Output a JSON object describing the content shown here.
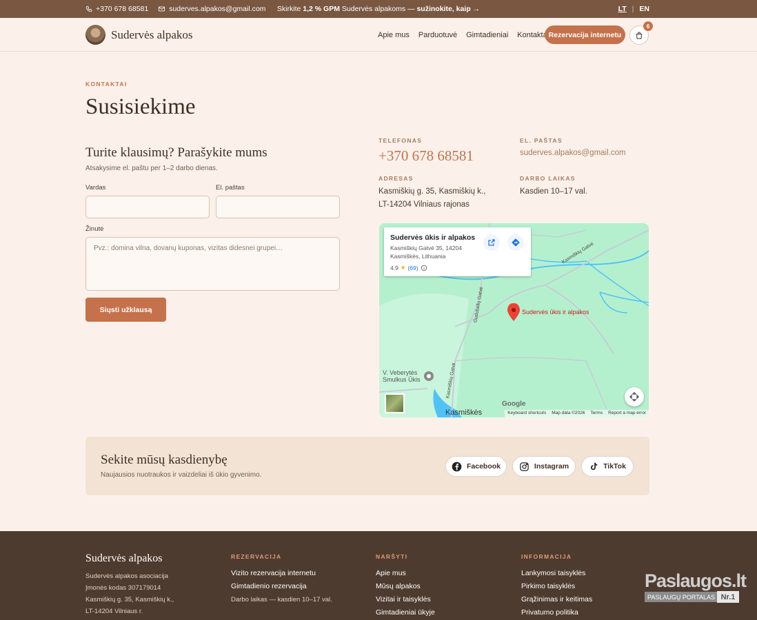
{
  "topbar": {
    "phone": "+370 678 68581",
    "email": "suderves.alpakos@gmail.com",
    "promo_prefix": "Skirkite",
    "promo_bold": "1,2 % GPM",
    "promo_middle": "Sudervės alpakoms —",
    "promo_link": "sužinokite, kaip →",
    "lang_lt": "LT",
    "lang_sep": "|",
    "lang_en": "EN"
  },
  "header": {
    "brand": "Sudervės alpakos",
    "nav": [
      "Apie mus",
      "Parduotuvė",
      "Gimtadieniai",
      "Kontaktai"
    ],
    "reserve_label": "Rezervacija internetu",
    "cart_count": "6"
  },
  "main": {
    "eyebrow": "KONTAKTAI",
    "title": "Susisiekime",
    "form": {
      "title": "Turite klausimų? Parašykite mums",
      "subtitle": "Atsakysime el. paštu per 1–2 darbo dienas.",
      "name_label": "Vardas",
      "email_label": "El. paštas",
      "message_label": "Žinutė",
      "message_placeholder": "Pvz.: domina vilna, dovanų kuponas, vizitas didesnei grupei…",
      "submit_label": "Siųsti užklausą"
    },
    "contact": {
      "phone_label": "TELEFONAS",
      "phone": "+370 678 68581",
      "email_label": "EL. PAŠTAS",
      "email": "suderves.alpakos@gmail.com",
      "address_label": "ADRESAS",
      "address_line1": "Kasmiškių g. 35, Kasmiškių k.,",
      "address_line2": "LT-14204 Vilniaus rajonas",
      "hours_label": "DARBO LAIKAS",
      "hours": "Kasdien 10–17 val."
    },
    "map": {
      "card_title": "Sudervės ūkis ir alpakos",
      "card_addr1": "Kasmiškių Gatvė 35, 14204",
      "card_addr2": "Kasmiškės, Lithuania",
      "rating": "4.9",
      "reviews": "(69)",
      "marker_label": "Sudervės ūkis ir alpakos",
      "poi_line1": "V. Veberytės",
      "poi_line2": "Smulkus Ūkis",
      "town": "Kasmiškės",
      "road1": "Kasmiškių Gatvė",
      "road2": "Gudobelių Gatvė",
      "road3": "Kasmiškių Gatvė",
      "google": "Google",
      "footer": [
        "Keyboard shortcuts",
        "Map data ©2026",
        "Terms",
        "Report a map error"
      ],
      "colors": {
        "land": "#b5f0ce",
        "water": "#4fc3f7",
        "road": "#c7ccd6",
        "marker": "#ea4335"
      }
    }
  },
  "social": {
    "title": "Sekite mūsų kasdienybę",
    "subtitle": "Naujausios nuotraukos ir vaizdeliai iš ūkio gyvenimo.",
    "buttons": [
      "Facebook",
      "Instagram",
      "TikTok"
    ]
  },
  "footer": {
    "brand": "Sudervės alpakos",
    "info": [
      "Sudervės alpakos asociacija",
      "Įmonės kodas 307179014",
      "Kasmiškių g. 35, Kasmiškių k.,",
      "LT-14204 Vilniaus r."
    ],
    "col1_title": "REZERVACIJA",
    "col1_items": [
      "Vizito rezervacija internetu",
      "Gimtadienio rezervacija"
    ],
    "col1_note": "Darbo laikas — kasdien 10–17 val.",
    "col2_title": "NARŠYTI",
    "col2_items": [
      "Apie mus",
      "Mūsų alpakos",
      "Vizitai ir taisyklės",
      "Gimtadieniai ūkyje"
    ],
    "col3_title": "INFORMACIJA",
    "col3_items": [
      "Lankymosi taisyklės",
      "Pirkimo taisyklės",
      "Grąžinimas ir keitimas",
      "Privatumo politika"
    ]
  },
  "badge": {
    "name": "Paslaugos.lt",
    "tag": "PASLAUGŲ PORTALAS",
    "rank": "Nr.1"
  },
  "colors": {
    "accent": "#c5714b",
    "topbar": "#7a5741",
    "footer": "#4e3b2f",
    "background": "#fbf1ea"
  }
}
